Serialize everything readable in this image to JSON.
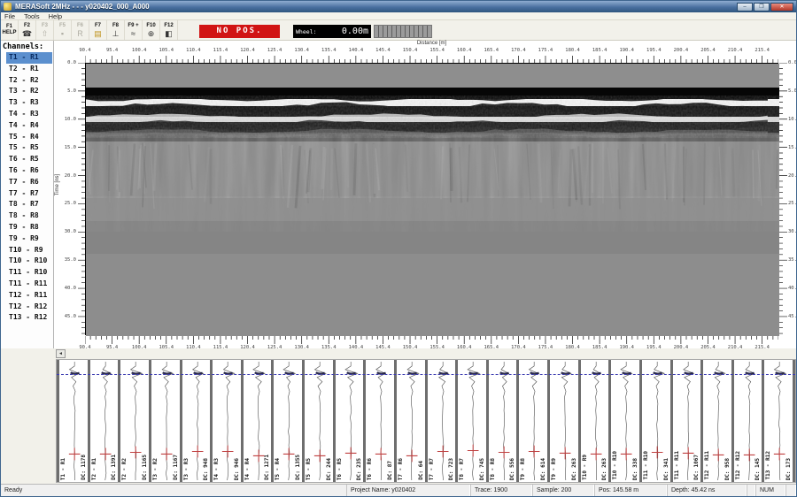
{
  "window": {
    "title": "MERASoft 2MHz - - - y020402_000_A000",
    "controls": {
      "minimize": "–",
      "maximize": "❐",
      "close": "✕"
    }
  },
  "menu": {
    "items": [
      "File",
      "Tools",
      "Help"
    ]
  },
  "toolbar": {
    "buttons": [
      {
        "key": "F1",
        "sub": "HELP",
        "icon": "help-icon",
        "glyph": "",
        "enabled": true
      },
      {
        "key": "F2",
        "icon": "probe-hook-icon",
        "glyph": "☎",
        "enabled": true
      },
      {
        "key": "F3",
        "icon": "arrow-up-icon",
        "glyph": "⇧",
        "enabled": false
      },
      {
        "key": "F5",
        "icon": "stop-square-icon",
        "glyph": "▪",
        "enabled": false
      },
      {
        "key": "F6",
        "icon": "record-icon",
        "glyph": "R",
        "enabled": false
      },
      {
        "key": "F7",
        "icon": "folder-open-icon",
        "glyph": "▤",
        "enabled": true
      },
      {
        "key": "F8",
        "icon": "plot-axes-icon",
        "glyph": "⊥",
        "enabled": true
      },
      {
        "key": "F9 +",
        "icon": "wiggle-icon",
        "glyph": "≈",
        "enabled": true
      },
      {
        "key": "F10",
        "icon": "crosshair-icon",
        "glyph": "⊕",
        "enabled": true
      },
      {
        "key": "F12",
        "icon": "contrast-icon",
        "glyph": "◧",
        "enabled": true
      }
    ],
    "no_pos_label": "NO POS.",
    "wheel_label": "Wheel:",
    "wheel_value": "0.00m",
    "colors": {
      "no_pos_bg": "#d11414",
      "no_pos_text": "#ffffff",
      "wheel_bg": "#000000"
    }
  },
  "channels": {
    "header": "Channels:",
    "selected_index": 0,
    "items": [
      "T1 - R1",
      "T2 - R1",
      "T2 - R2",
      "T3 - R2",
      "T3 - R3",
      "T4 - R3",
      "T4 - R4",
      "T5 - R4",
      "T5 - R5",
      "T6 - R5",
      "T6 - R6",
      "T7 - R6",
      "T7 - R7",
      "T8 - R7",
      "T8 - R8",
      "T9 - R8",
      "T9 - R9",
      "T10 - R9",
      "T10 - R10",
      "T11 - R10",
      "T11 - R11",
      "T12 - R11",
      "T12 - R12",
      "T13 - R12"
    ]
  },
  "radargram": {
    "x_axis_label": "Distance [m]",
    "y_axis_label": "Time [ns]",
    "x_ticks": [
      "90.4",
      "95.4",
      "100.4",
      "105.4",
      "110.4",
      "115.4",
      "120.4",
      "125.4",
      "130.4",
      "135.4",
      "140.4",
      "145.4",
      "150.4",
      "155.4",
      "160.4",
      "165.4",
      "170.4",
      "175.4",
      "180.4",
      "185.4",
      "190.4",
      "195.4",
      "200.4",
      "205.4",
      "210.4",
      "215.4"
    ],
    "y_ticks": [
      "0.0",
      "5.0",
      "10.0",
      "15.0",
      "20.0",
      "25.0",
      "30.0",
      "35.0",
      "40.0",
      "45.0"
    ],
    "x_range": [
      90.4,
      218.4
    ],
    "y_range": [
      0,
      48.3
    ],
    "x_minor_step": 1,
    "y_minor_step": 1
  },
  "trace_panel": {
    "baseline_color": "#3b3bb0",
    "marker_color": "#c04040",
    "cells": [
      {
        "channel": "T1 - R1",
        "dc": "DC: 1178"
      },
      {
        "channel": "T2 - R1",
        "dc": "DC: 1391"
      },
      {
        "channel": "T2 - R2",
        "dc": "DC: 1165"
      },
      {
        "channel": "T3 - R2",
        "dc": "DC: 1167"
      },
      {
        "channel": "T3 - R3",
        "dc": "DC: 948"
      },
      {
        "channel": "T4 - R3",
        "dc": "DC: 946"
      },
      {
        "channel": "T4 - R4",
        "dc": "DC: 1271"
      },
      {
        "channel": "T5 - R4",
        "dc": "DC: 1355"
      },
      {
        "channel": "T5 - R5",
        "dc": "DC: 244"
      },
      {
        "channel": "T6 - R5",
        "dc": "DC: 235"
      },
      {
        "channel": "T6 - R6",
        "dc": "DC: 87"
      },
      {
        "channel": "T7 - R6",
        "dc": "DC: 64"
      },
      {
        "channel": "T7 - R7",
        "dc": "DC: 723"
      },
      {
        "channel": "T8 - R7",
        "dc": "DC: 745"
      },
      {
        "channel": "T8 - R8",
        "dc": "DC: 556"
      },
      {
        "channel": "T9 - R8",
        "dc": "DC: 614"
      },
      {
        "channel": "T9 - R9",
        "dc": "DC: 263"
      },
      {
        "channel": "T10 - R9",
        "dc": "DC: 263"
      },
      {
        "channel": "T10 - R10",
        "dc": "DC: 338"
      },
      {
        "channel": "T11 - R10",
        "dc": "DC: 341"
      },
      {
        "channel": "T11 - R11",
        "dc": "DC: 1067"
      },
      {
        "channel": "T12 - R11",
        "dc": "DC: 958"
      },
      {
        "channel": "T12 - R12",
        "dc": "DC: 145"
      },
      {
        "channel": "T13 - R12",
        "dc": "DC: 173"
      }
    ]
  },
  "statusbar": {
    "ready": "Ready",
    "num_indicator": "NUM",
    "panels": [
      "Project Name: y020402",
      "Trace: 1900",
      "Sample: 200",
      "Pos: 145.58 m",
      "Depth:  45.42 ns",
      "",
      "NUM",
      ""
    ]
  }
}
